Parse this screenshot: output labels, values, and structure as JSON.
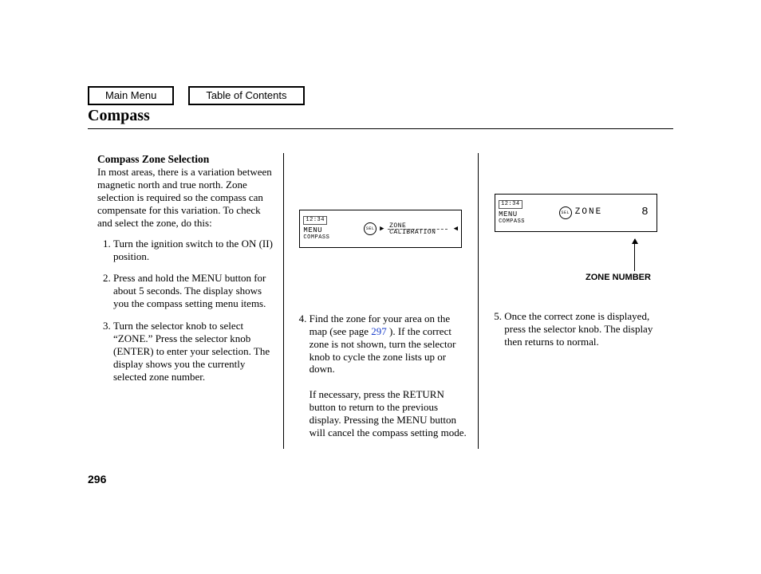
{
  "nav": {
    "main_menu": "Main Menu",
    "toc": "Table of Contents"
  },
  "title": "Compass",
  "page_number": "296",
  "col1": {
    "heading": "Compass Zone Selection",
    "intro": "In most areas, there is a variation between magnetic north and true north. Zone selection is required so the compass can compensate for this variation. To check and select the zone, do this:",
    "step1": "Turn the ignition switch to the ON (II) position.",
    "step2": "Press and hold the MENU button for about 5 seconds. The display shows you the compass setting menu items.",
    "step3": "Turn the selector knob to select “ZONE.” Press the selector knob (ENTER) to enter your selection. The display shows you the currently selected zone number."
  },
  "col2": {
    "lcd_clock": "12:34",
    "lcd_menu": "MENU",
    "lcd_compass": "COMPASS",
    "lcd_sel": "SEL",
    "lcd_zone": "ZONE",
    "lcd_cal": "CALIBRATION",
    "step4a": "Find the zone for your area on the map (see page ",
    "ref": "297",
    "step4b": " ). If the correct zone is not shown, turn the selector knob to cycle the zone lists up or down.",
    "step4c": "If necessary, press the RETURN button to return to the previous display. Pressing the MENU button will cancel the compass setting mode."
  },
  "col3": {
    "lcd_clock": "12:34",
    "lcd_menu": "MENU",
    "lcd_compass": "COMPASS",
    "lcd_sel": "SEL",
    "lcd_zone": "ZONE",
    "lcd_number": "8",
    "zone_label": "ZONE NUMBER",
    "step5": "Once the correct zone is displayed, press the selector knob. The display then returns to normal."
  }
}
